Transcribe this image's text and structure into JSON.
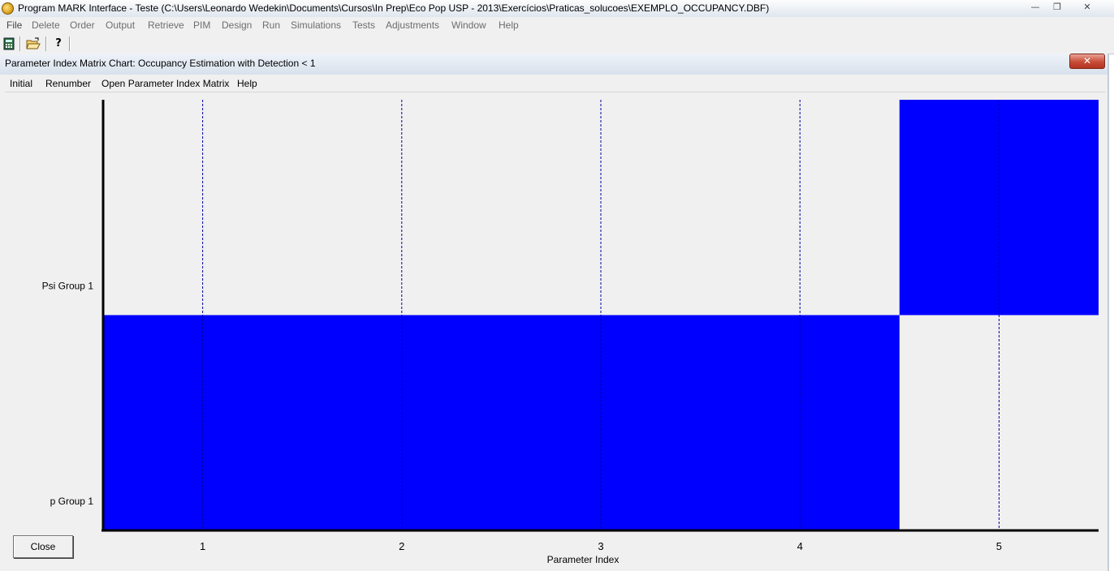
{
  "app": {
    "title": "Program MARK Interface - Teste  (C:\\Users\\Leonardo Wedekin\\Documents\\Cursos\\In Prep\\Eco Pop USP - 2013\\Exercícios\\Praticas_solucoes\\EXEMPLO_OCCUPANCY.DBF)",
    "minimize": "—",
    "restore": "❐",
    "close": "✕"
  },
  "menu": {
    "items": [
      "File",
      "Delete",
      "Order",
      "Output",
      "Retrieve",
      "PIM",
      "Design",
      "Run",
      "Simulations",
      "Tests",
      "Adjustments",
      "Window",
      "Help"
    ]
  },
  "toolbar": {
    "calc_icon": "calculator-icon",
    "open_icon": "open-folder-icon",
    "help_label": "?"
  },
  "child": {
    "title": "Parameter Index Matrix Chart: Occupancy Estimation with Detection < 1",
    "close": "✕",
    "menu": [
      "Initial",
      "Renumber",
      "Open Parameter Index Matrix",
      "Help"
    ],
    "close_button": "Close"
  },
  "colors": {
    "bar": "#0000ff",
    "grid": "#0000a0",
    "axis": "#000000"
  },
  "chart_data": {
    "type": "bar",
    "orientation": "horizontal",
    "xlabel": "Parameter Index",
    "ylabel": "",
    "xlim": [
      0.5,
      5.5
    ],
    "xticks": [
      1,
      2,
      3,
      4,
      5
    ],
    "grid": "vertical dashed at ticks",
    "categories": [
      "p Group 1",
      "Psi Group 1"
    ],
    "series": [
      {
        "name": "p Group 1",
        "start": 0.5,
        "end": 4.5
      },
      {
        "name": "Psi Group 1",
        "start": 4.5,
        "end": 5.5
      }
    ]
  }
}
